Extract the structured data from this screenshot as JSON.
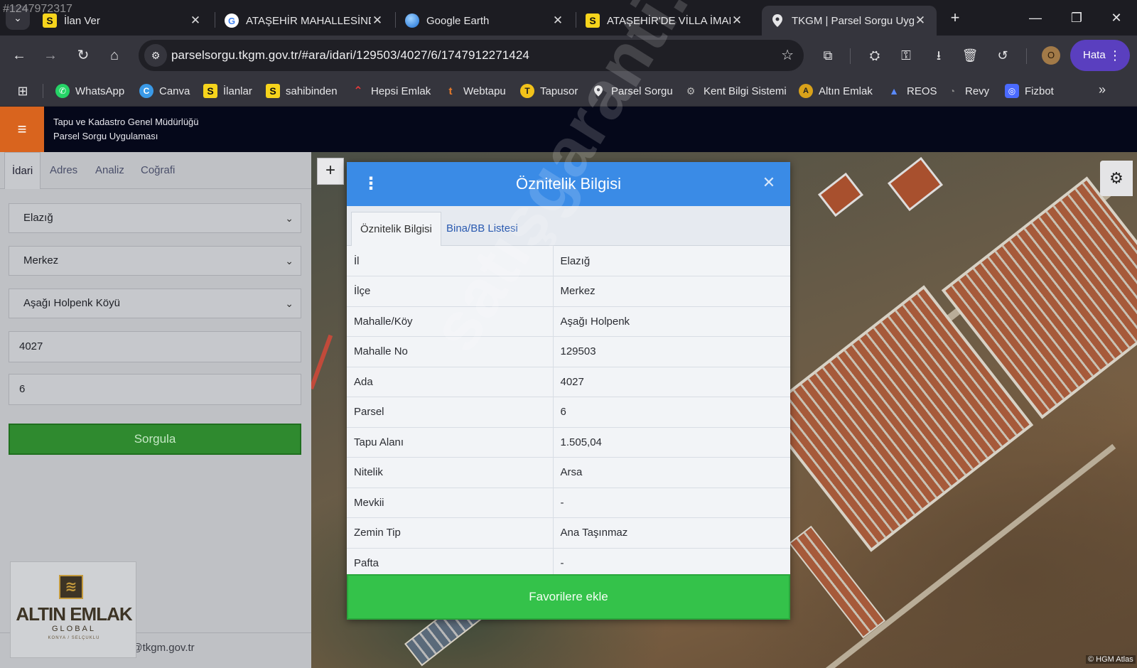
{
  "corner_id": "#1247972317",
  "tabs": [
    {
      "favicon": "S",
      "title": "İlan Ver",
      "active": false
    },
    {
      "favicon": "G",
      "title": "ATAŞEHİR MAHALLESİNDE",
      "active": false
    },
    {
      "favicon": "earth",
      "title": "Google Earth",
      "active": false
    },
    {
      "favicon": "S",
      "title": "ATAŞEHİR'DE VİLLA İMAR",
      "active": false
    },
    {
      "favicon": "pin",
      "title": "TKGM | Parsel Sorgu Uyg",
      "active": true
    }
  ],
  "toolbar": {
    "url": "parselsorgu.tkgm.gov.tr/#ara/idari/129503/4027/6/1747912271424",
    "profile_initial": "O",
    "error_button": "Hata"
  },
  "bookmarks": [
    {
      "icon": "whatsapp-icon",
      "label": "WhatsApp"
    },
    {
      "icon": "canva-icon",
      "label": "Canva"
    },
    {
      "icon": "s-icon",
      "label": "İlanlar"
    },
    {
      "icon": "s-icon",
      "label": "sahibinden"
    },
    {
      "icon": "hepsiemlak-icon",
      "label": "Hepsi Emlak"
    },
    {
      "icon": "webtapu-icon",
      "label": "Webtapu"
    },
    {
      "icon": "tapusor-icon",
      "label": "Tapusor"
    },
    {
      "icon": "pin-icon",
      "label": "Parsel Sorgu"
    },
    {
      "icon": "kbs-icon",
      "label": "Kent Bilgi Sistemi"
    },
    {
      "icon": "altin-icon",
      "label": "Altın Emlak"
    },
    {
      "icon": "reos-icon",
      "label": "REOS"
    },
    {
      "icon": "revy-icon",
      "label": "Revy"
    },
    {
      "icon": "fizbot-icon",
      "label": "Fizbot"
    }
  ],
  "site_header": {
    "line1": "Tapu ve Kadastro Genel Müdürlüğü",
    "line2": "Parsel Sorgu Uygulaması"
  },
  "left_panel": {
    "tabs": [
      "İdari",
      "Adres",
      "Analiz",
      "Coğrafi"
    ],
    "il": "Elazığ",
    "ilce": "Merkez",
    "mahalle": "Aşağı Holpenk Köyü",
    "ada": "4027",
    "parsel": "6",
    "query_button": "Sorgula",
    "email": "cbs@tkgm.gov.tr"
  },
  "logo": {
    "name": "ALTIN EMLAK",
    "sub": "GLOBAL",
    "sub2": "KONYA / SELÇUKLU"
  },
  "dialog": {
    "title": "Öznitelik Bilgisi",
    "tabs": [
      "Öznitelik Bilgisi",
      "Bina/BB Listesi"
    ],
    "rows": [
      {
        "key": "İl",
        "value": "Elazığ"
      },
      {
        "key": "İlçe",
        "value": "Merkez"
      },
      {
        "key": "Mahalle/Köy",
        "value": "Aşağı Holpenk"
      },
      {
        "key": "Mahalle No",
        "value": "129503"
      },
      {
        "key": "Ada",
        "value": "4027"
      },
      {
        "key": "Parsel",
        "value": "6"
      },
      {
        "key": "Tapu Alanı",
        "value": "1.505,04"
      },
      {
        "key": "Nitelik",
        "value": "Arsa"
      },
      {
        "key": "Mevkii",
        "value": "-"
      },
      {
        "key": "Zemin Tip",
        "value": "Ana Taşınmaz"
      },
      {
        "key": "Pafta",
        "value": "-"
      }
    ],
    "favorite_button": "Favorilere ekle"
  },
  "map": {
    "attribution": "© HGM Atlas"
  },
  "watermark": "satışgaranti.com",
  "colors": {
    "dialog_header": "#3a8be6",
    "favorite_button": "#34c24a",
    "query_button": "#2f8a2f",
    "hamburger": "#d9641e",
    "header_bg": "#05081a"
  }
}
